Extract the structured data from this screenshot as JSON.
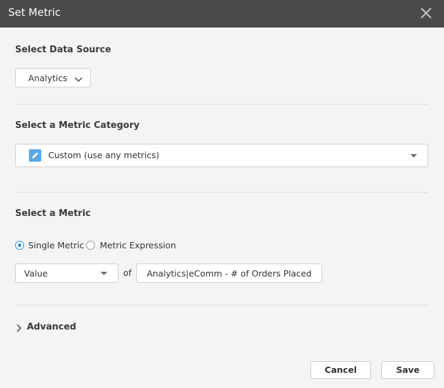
{
  "dialog": {
    "title": "Set Metric",
    "close_icon": "close-x-icon"
  },
  "data_source": {
    "label": "Select Data Source",
    "selected": "Analytics",
    "icon": "chevron-down-icon"
  },
  "category": {
    "label": "Select a Metric Category",
    "selected": "Custom (use any metrics)",
    "icon": "pencil-icon",
    "icon_color": "#5aa9e6"
  },
  "metric": {
    "label": "Select a Metric",
    "modes": [
      {
        "label": "Single Metric",
        "checked": true
      },
      {
        "label": "Metric Expression",
        "checked": false
      }
    ],
    "aggregation": "Value",
    "of_text": "of",
    "metric_name": "Analytics|eComm - # of Orders Placed"
  },
  "advanced": {
    "label": "Advanced",
    "icon": "chevron-right-icon"
  },
  "footer": {
    "cancel_label": "Cancel",
    "save_label": "Save"
  },
  "colors": {
    "title_bar": "#4a4a4a",
    "background": "#f4f4f4",
    "accent": "#2b8fe0"
  }
}
